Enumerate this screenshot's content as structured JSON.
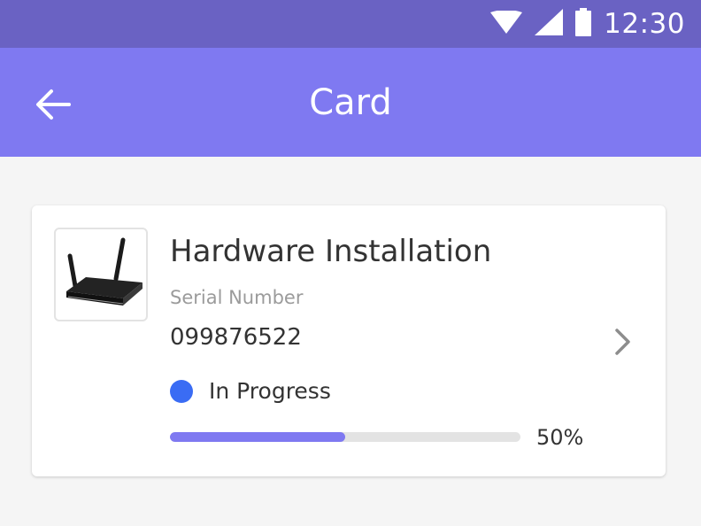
{
  "status_bar": {
    "time": "12:30",
    "icons": [
      "wifi-icon",
      "cellular-signal-icon",
      "battery-icon"
    ]
  },
  "app_bar": {
    "title": "Card",
    "back_icon": "arrow-left-icon"
  },
  "card": {
    "image": "router-image",
    "title": "Hardware Installation",
    "serial_label": "Serial Number",
    "serial_value": "099876522",
    "status": {
      "label": "In Progress",
      "color": "#3a6cf4"
    },
    "progress": {
      "value": 0.5,
      "label": "50%"
    },
    "chevron_icon": "chevron-right-icon"
  },
  "colors": {
    "status_bar": "#6a62c3",
    "app_bar": "#7f79f1",
    "accent": "#7f79f1",
    "background": "#f5f5f5"
  }
}
